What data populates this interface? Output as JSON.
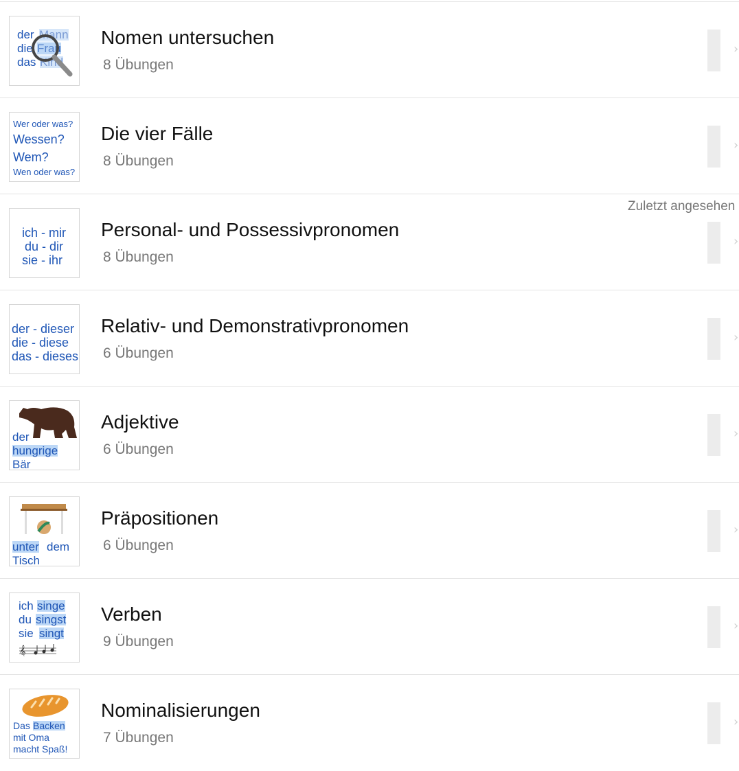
{
  "lessons": [
    {
      "title": "Nomen untersuchen",
      "subtitle": "8 Übungen",
      "thumb": [
        "der",
        "Mann",
        "die",
        "Frau",
        "das",
        "Kind"
      ]
    },
    {
      "title": "Die vier Fälle",
      "subtitle": "8 Übungen",
      "thumb": [
        "Wer oder was?",
        "Wessen?",
        "Wem?",
        "Wen oder was?"
      ]
    },
    {
      "title": "Personal- und Possessivpronomen",
      "subtitle": "8 Übungen",
      "thumb": [
        "ich - mir",
        "du - dir",
        "sie - ihr"
      ]
    },
    {
      "title": "Relativ- und Demonstrativpronomen",
      "subtitle": "6 Übungen",
      "thumb": [
        "der - dieser",
        "die - diese",
        "das - dieses"
      ]
    },
    {
      "title": "Adjektive",
      "subtitle": "6 Übungen",
      "thumb": [
        "der",
        "hungrige",
        "Bär"
      ]
    },
    {
      "title": "Präpositionen",
      "subtitle": "6 Übungen",
      "thumb": [
        "unter",
        "dem",
        "Tisch"
      ]
    },
    {
      "title": "Verben",
      "subtitle": "9 Übungen",
      "thumb": [
        "ich",
        "singe",
        "du",
        "singst",
        "sie",
        "singt"
      ]
    },
    {
      "title": "Nominalisierungen",
      "subtitle": "7 Übungen",
      "thumb": [
        "Das",
        "Backen",
        "mit Oma",
        "macht Spaß!"
      ]
    }
  ],
  "recently_viewed_label": "Zuletzt angesehen",
  "colors": {
    "accent_text": "#1f56b6",
    "highlight": "#bcd7f6",
    "progress_track": "#ececec"
  },
  "icons": [
    "magnifier-icon",
    "bear-icon",
    "table-ball-icon",
    "music-notes-icon",
    "bread-icon",
    "chevron-right-icon"
  ]
}
